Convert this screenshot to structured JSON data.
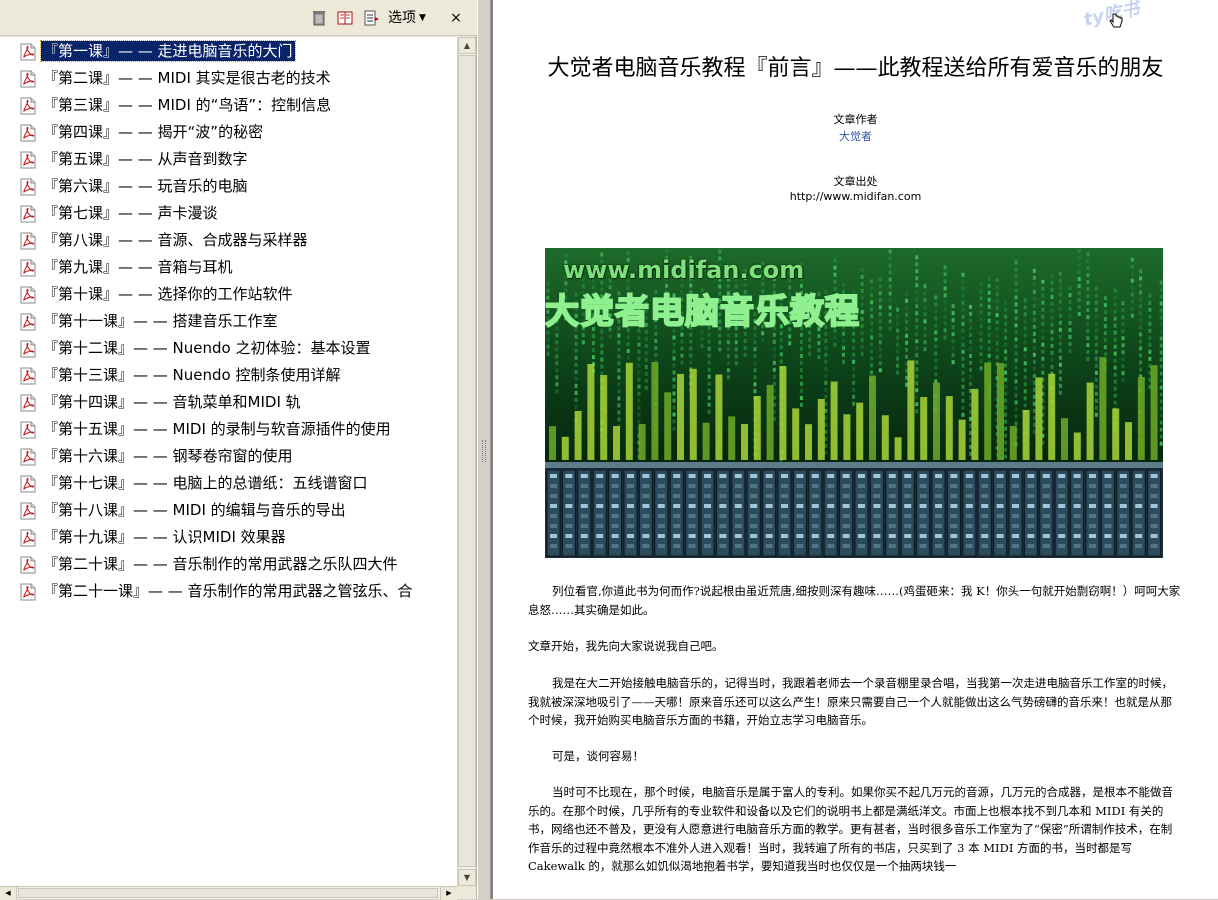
{
  "toolbar": {
    "options_label": "选项",
    "close_label": "×"
  },
  "bookmarks": [
    "『第一课』— — 走进电脑音乐的大门",
    "『第二课』— — MIDI 其实是很古老的技术",
    "『第三课』— — MIDI 的“鸟语”：控制信息",
    "『第四课』— — 揭开“波”的秘密",
    "『第五课』— — 从声音到数字",
    "『第六课』— — 玩音乐的电脑",
    "『第七课』— — 声卡漫谈",
    "『第八课』— — 音源、合成器与采样器",
    "『第九课』— — 音箱与耳机",
    "『第十课』— — 选择你的工作站软件",
    "『第十一课』— — 搭建音乐工作室",
    "『第十二课』— — Nuendo 之初体验：基本设置",
    "『第十三课』— — Nuendo 控制条使用详解",
    "『第十四课』— — 音轨菜单和MIDI 轨",
    "『第十五课』— — MIDI 的录制与软音源插件的使用",
    "『第十六课』— — 钢琴卷帘窗的使用",
    "『第十七课』— — 电脑上的总谱纸：五线谱窗口",
    "『第十八课』— — MIDI 的编辑与音乐的导出",
    "『第十九课』— — 认识MIDI 效果器",
    "『第二十课』— — 音乐制作的常用武器之乐队四大件",
    "『第二十一课』— — 音乐制作的常用武器之管弦乐、合"
  ],
  "document": {
    "watermark": "ty吃书",
    "title": "大觉者电脑音乐教程『前言』——此教程送给所有爱音乐的朋友",
    "author_label": "文章作者",
    "author_name": "大觉者",
    "source_label": "文章出处",
    "source_url": "http://www.midifan.com",
    "banner_url_text": "www.midifan.com",
    "banner_title_text": "大觉者电脑音乐教程",
    "paragraphs": [
      "列位看官,你道此书为何而作?说起根由虽近荒唐,细按则深有趣味……(鸡蛋砸来：我 K！你头一句就开始剽窃啊！）呵呵大家息怒……其实确是如此。",
      "文章开始，我先向大家说说我自己吧。",
      "我是在大二开始接触电脑音乐的，记得当时，我跟着老师去一个录音棚里录合唱，当我第一次走进电脑音乐工作室的时候，我就被深深地吸引了——天哪！原来音乐还可以这么产生！原来只需要自己一个人就能做出这么气势磅礴的音乐来！也就是从那个时候，我开始购买电脑音乐方面的书籍，开始立志学习电脑音乐。",
      "可是，谈何容易！",
      "当时可不比现在，那个时候，电脑音乐是属于富人的专利。如果你买不起几万元的音源，几万元的合成器，是根本不能做音乐的。在那个时候，几乎所有的专业软件和设备以及它们的说明书上都是满纸洋文。市面上也根本找不到几本和 MIDI 有关的书，网络也还不普及，更没有人愿意进行电脑音乐方面的教学。更有甚者，当时很多音乐工作室为了“保密”所谓制作技术，在制作音乐的过程中竟然根本不准外人进入观看！当时，我转遍了所有的书店，只买到了 3 本 MIDI 方面的书，当时都是写 Cakewalk 的，就那么如饥似渴地抱着书学，要知道我当时也仅仅是一个抽两块钱一"
    ]
  },
  "colors": {
    "selection": "#0a246a",
    "panel": "#ece9d8",
    "banner_green": "#7de07d"
  }
}
